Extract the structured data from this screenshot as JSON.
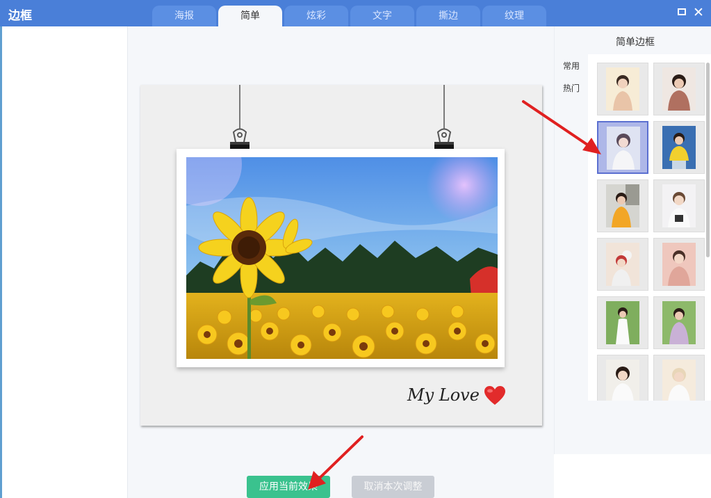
{
  "window": {
    "title": "边框"
  },
  "tabs": [
    {
      "label": "海报",
      "active": false
    },
    {
      "label": "简单",
      "active": true
    },
    {
      "label": "炫彩",
      "active": false
    },
    {
      "label": "文字",
      "active": false
    },
    {
      "label": "撕边",
      "active": false
    },
    {
      "label": "纹理",
      "active": false
    }
  ],
  "window_controls": {
    "maximize_icon": "maximize-icon",
    "close_icon": "close-icon",
    "close_glyph": "✕"
  },
  "preview": {
    "caption": "My Love",
    "heart_color": "#e22b2b"
  },
  "buttons": {
    "apply": "应用当前效果",
    "cancel": "取消本次调整"
  },
  "right_panel": {
    "title": "简单边框",
    "categories": [
      "常用",
      "热门"
    ],
    "thumbnail_count": 12,
    "selected_index": 2
  },
  "colors": {
    "titlebar": "#4a7fd8",
    "apply": "#3ac28e",
    "cancel": "#c9cdd4",
    "arrow": "#e02020"
  }
}
